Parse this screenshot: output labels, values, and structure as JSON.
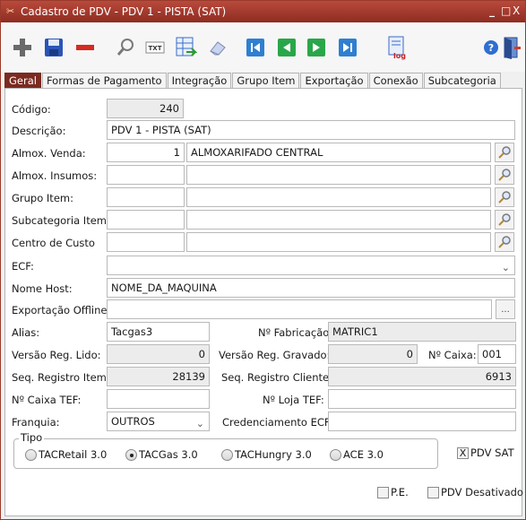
{
  "window": {
    "title": "Cadastro de PDV - PDV 1 -  PISTA (SAT)",
    "minimize": "_",
    "maximize": "□",
    "close": "X"
  },
  "toolbar": {
    "buttons": [
      {
        "name": "add-icon"
      },
      {
        "name": "save-icon"
      },
      {
        "name": "delete-icon"
      },
      {
        "name": "search-icon"
      },
      {
        "name": "txt-icon",
        "label": "TXT"
      },
      {
        "name": "export-grid-icon"
      },
      {
        "name": "eraser-icon"
      },
      {
        "name": "first-record-icon"
      },
      {
        "name": "previous-record-icon"
      },
      {
        "name": "next-record-icon"
      },
      {
        "name": "last-record-icon"
      },
      {
        "name": "log-icon",
        "label": "log"
      },
      {
        "name": "help-icon"
      },
      {
        "name": "exit-icon"
      }
    ]
  },
  "tabs": [
    {
      "label": "Geral",
      "active": true
    },
    {
      "label": "Formas de Pagamento"
    },
    {
      "label": "Integração"
    },
    {
      "label": "Grupo Item"
    },
    {
      "label": "Exportação"
    },
    {
      "label": "Conexão"
    },
    {
      "label": "Subcategoria"
    }
  ],
  "form": {
    "codigo": {
      "label": "Código:",
      "value": "240"
    },
    "descricao": {
      "label": "Descrição:",
      "value": "PDV 1 - PISTA (SAT)"
    },
    "almox_venda": {
      "label": "Almox. Venda:",
      "code": "1",
      "name": "ALMOXARIFADO CENTRAL"
    },
    "almox_insumos": {
      "label": "Almox. Insumos:",
      "code": "",
      "name": ""
    },
    "grupo_item": {
      "label": "Grupo Item:",
      "code": "",
      "name": ""
    },
    "subcategoria_item": {
      "label": "Subcategoria Item:",
      "code": "",
      "name": ""
    },
    "centro_custo": {
      "label": "Centro de Custo",
      "code": "",
      "name": ""
    },
    "ecf": {
      "label": "ECF:",
      "value": ""
    },
    "nome_host": {
      "label": "Nome Host:",
      "value": "NOME_DA_MAQUINA"
    },
    "exportacao_offline": {
      "label": "Exportação Offline:",
      "value": "",
      "button": "..."
    },
    "alias": {
      "label": "Alias:",
      "value": "Tacgas3"
    },
    "n_fabricacao": {
      "label": "Nº Fabricação:",
      "value": "MATRIC1"
    },
    "versao_reg_lido": {
      "label": "Versão Reg. Lido:",
      "value": "0"
    },
    "versao_reg_gravado": {
      "label": "Versão Reg. Gravado:",
      "value": "0"
    },
    "n_caixa": {
      "label": "Nº Caixa:",
      "value": "001"
    },
    "seq_registro_item": {
      "label": "Seq. Registro Item:",
      "value": "28139"
    },
    "seq_registro_cliente": {
      "label": "Seq. Registro Cliente:",
      "value": "6913"
    },
    "n_caixa_tef": {
      "label": "Nº Caixa TEF:",
      "value": ""
    },
    "n_loja_tef": {
      "label": "Nº Loja TEF:",
      "value": ""
    },
    "franquia": {
      "label": "Franquia:",
      "value": "OUTROS"
    },
    "credenciamento_ecf": {
      "label": "Credenciamento ECF:",
      "value": ""
    },
    "tipo": {
      "label": "Tipo",
      "options": [
        "TACRetail 3.0",
        "TACGas 3.0",
        "TACHungry 3.0",
        "ACE 3.0"
      ],
      "selected": "TACGas 3.0"
    },
    "pdv_sat": {
      "label": "PDV SAT",
      "checked": true,
      "mark": "X"
    },
    "pe": {
      "label": "P.E.",
      "checked": false
    },
    "pdv_desativado": {
      "label": "PDV Desativado",
      "checked": false
    }
  }
}
